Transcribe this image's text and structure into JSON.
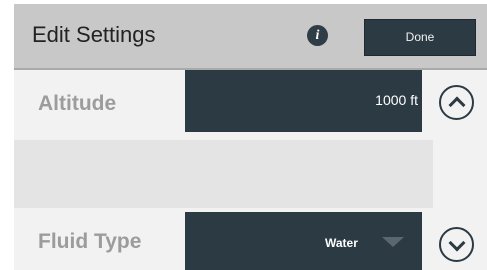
{
  "header": {
    "title": "Edit Settings",
    "info_icon": "info-icon",
    "done_label": "Done"
  },
  "settings": [
    {
      "label": "Altitude",
      "value": "1000 ft"
    },
    {
      "label": "Fluid Type",
      "value": "Water"
    }
  ],
  "controls": {
    "up_icon": "chevron-up-icon",
    "down_icon": "chevron-down-icon"
  },
  "colors": {
    "header_bg": "#c8c8c8",
    "field_bg": "#2c3a44",
    "label_color": "#9c9c9c"
  }
}
